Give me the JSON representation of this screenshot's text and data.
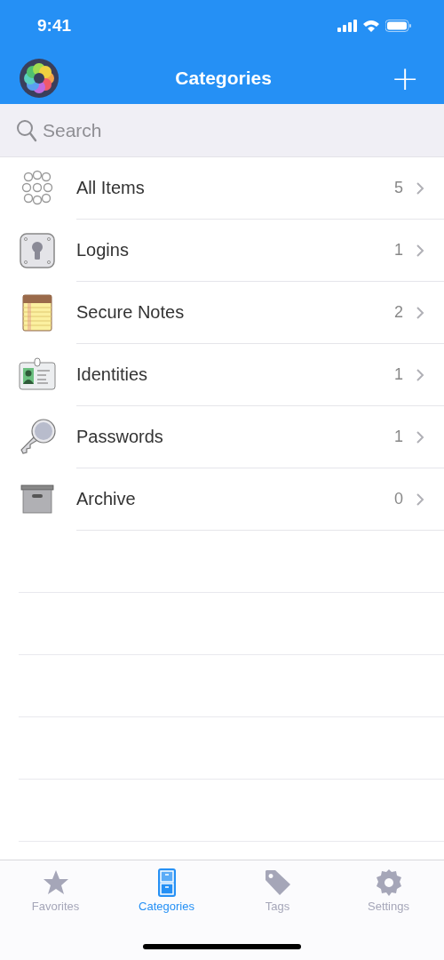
{
  "status_bar": {
    "time": "9:41"
  },
  "nav": {
    "title": "Categories",
    "add": "+"
  },
  "search": {
    "placeholder": "Search"
  },
  "categories": [
    {
      "kind": "all",
      "name": "All Items",
      "count": "5"
    },
    {
      "kind": "login",
      "name": "Logins",
      "count": "1"
    },
    {
      "kind": "note",
      "name": "Secure Notes",
      "count": "2"
    },
    {
      "kind": "identity",
      "name": "Identities",
      "count": "1"
    },
    {
      "kind": "password",
      "name": "Passwords",
      "count": "1"
    },
    {
      "kind": "archive",
      "name": "Archive",
      "count": "0"
    }
  ],
  "tabs": [
    {
      "kind": "star",
      "label": "Favorites",
      "selected": false
    },
    {
      "kind": "cabinet",
      "label": "Categories",
      "selected": true
    },
    {
      "kind": "tag",
      "label": "Tags",
      "selected": false
    },
    {
      "kind": "gear",
      "label": "Settings",
      "selected": false
    }
  ]
}
